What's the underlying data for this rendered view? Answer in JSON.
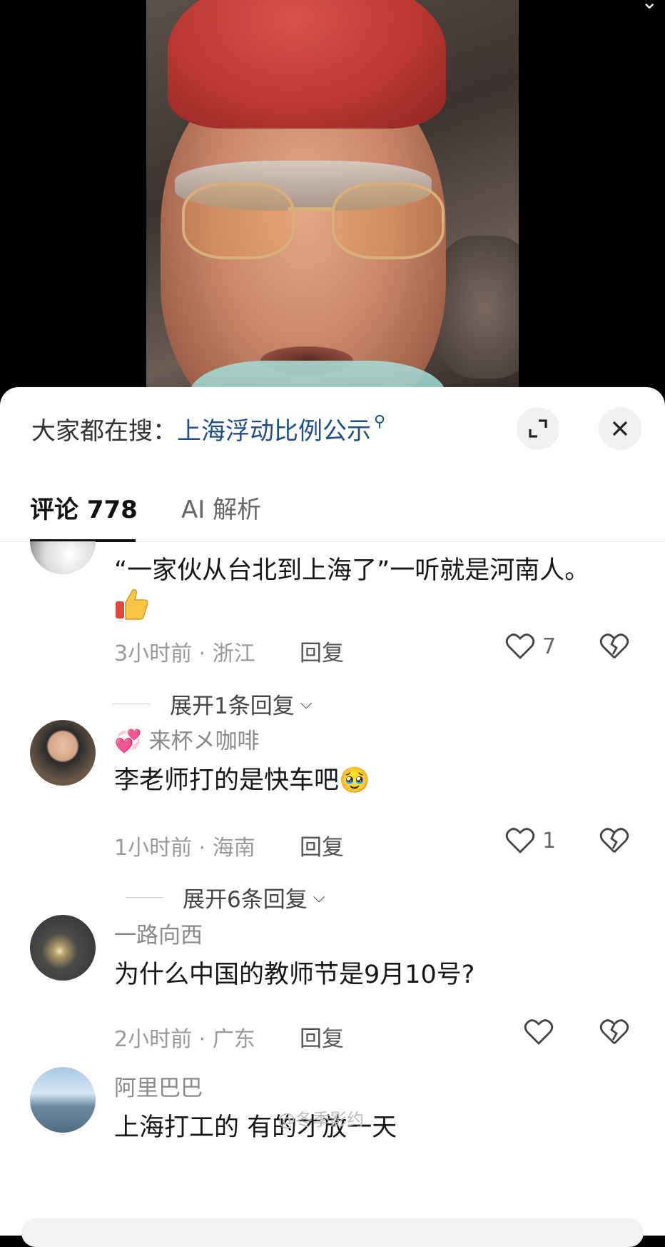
{
  "search": {
    "prefix": "大家都在搜：",
    "term": "上海浮动比例公示",
    "search_glyph": "⚲"
  },
  "tabs": {
    "comments_label": "评论 778",
    "ai_label": "AI 解析"
  },
  "comments": [
    {
      "username": "",
      "text": "“一家伙从台北到上海了”一听就是河南人。",
      "emoji": "thumbs-up",
      "time": "3小时前",
      "location": "浙江",
      "reply_label": "回复",
      "likes": "7",
      "expand_label": "展开1条回复"
    },
    {
      "username": "来杯メ咖啡",
      "username_emoji": "💞",
      "text": "李老师打的是快车吧🥹",
      "time": "1小时前",
      "location": "海南",
      "reply_label": "回复",
      "likes": "1",
      "expand_label": "展开6条回复"
    },
    {
      "username": "一路向西",
      "text": "为什么中国的教师节是9月10号?",
      "time": "2小时前",
      "location": "广东",
      "reply_label": "回复",
      "likes": ""
    },
    {
      "username": "阿里巴巴",
      "text": "上海打工的 有的才放一天"
    }
  ],
  "meta_separator": " · ",
  "watermark": "@冬季影约",
  "colors": {
    "search_term": "#1f4e8c",
    "text_primary": "#161616",
    "text_secondary": "#9a9a9a",
    "sheet_bg": "#ffffff",
    "cap_red": "#b73631"
  },
  "icons": [
    "chevron-down-icon",
    "expand-icon",
    "close-icon",
    "heart-icon",
    "broken-heart-icon",
    "thumbs-up-icon"
  ]
}
